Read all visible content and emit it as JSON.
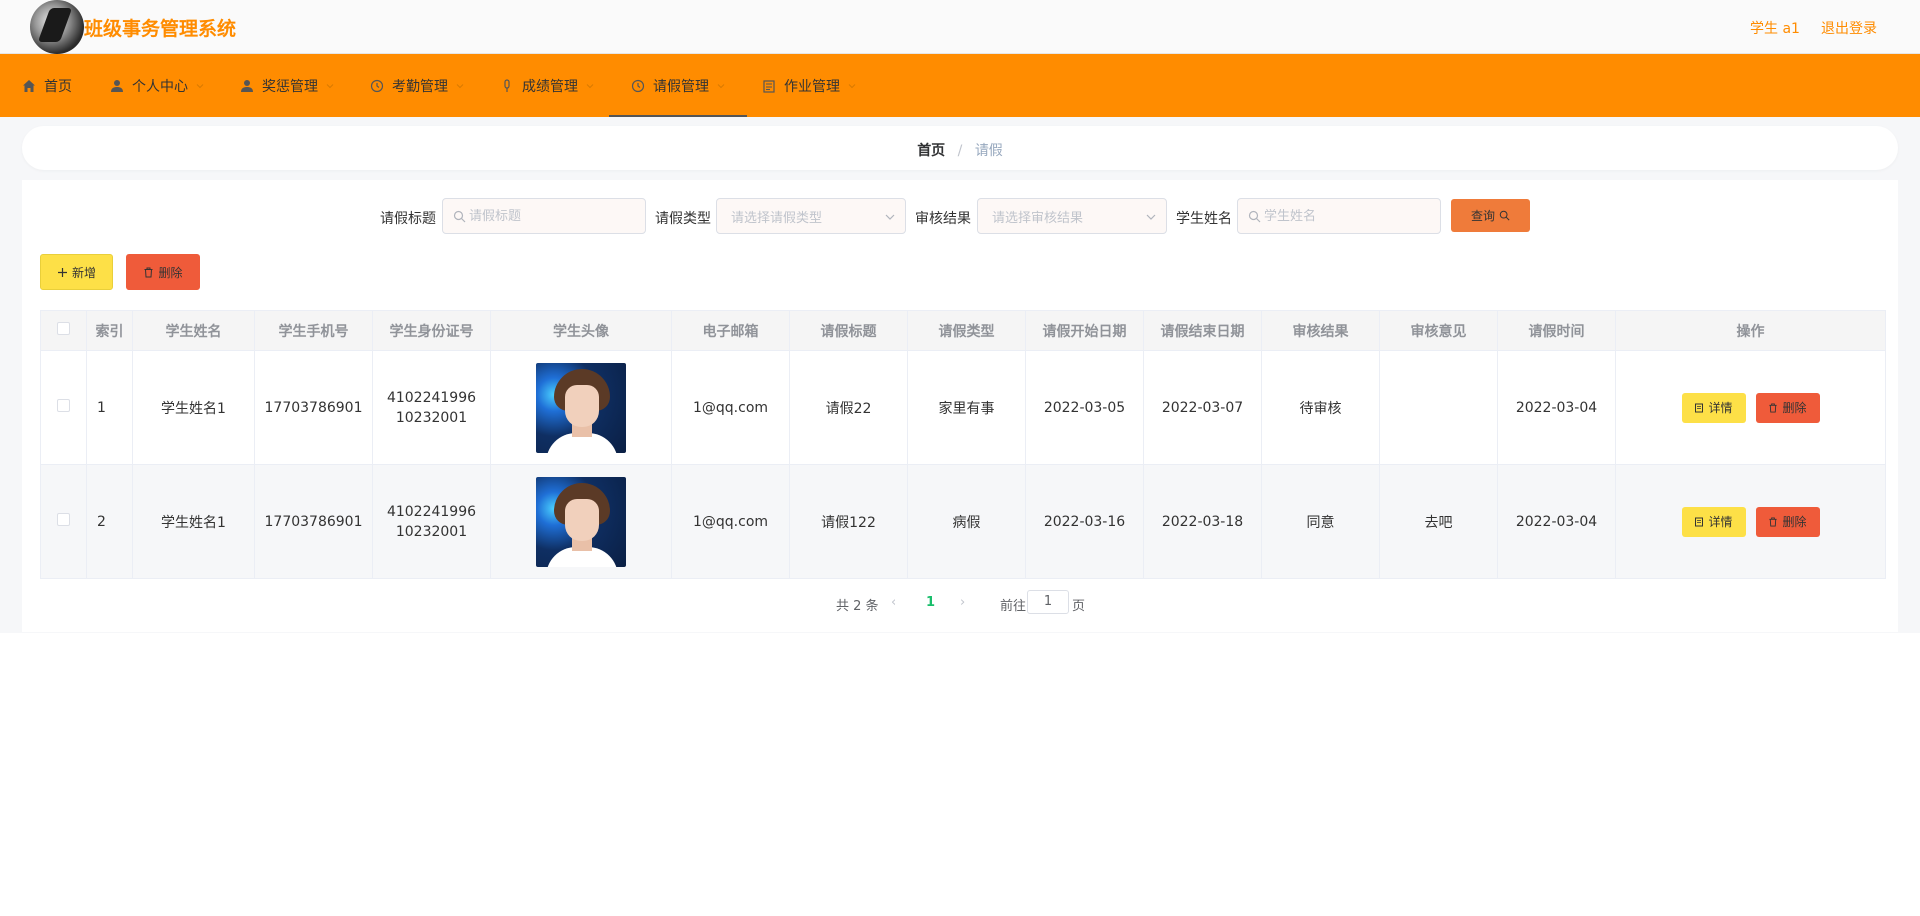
{
  "header": {
    "title": "班级事务管理系统",
    "user": "学生 a1",
    "logout": "退出登录"
  },
  "nav": {
    "items": [
      {
        "label": "首页",
        "icon": "home-icon"
      },
      {
        "label": "个人中心",
        "icon": "user-icon"
      },
      {
        "label": "奖惩管理",
        "icon": "user-icon"
      },
      {
        "label": "考勤管理",
        "icon": "clock-icon"
      },
      {
        "label": "成绩管理",
        "icon": "mic-icon"
      },
      {
        "label": "请假管理",
        "icon": "clock-icon"
      },
      {
        "label": "作业管理",
        "icon": "document-icon"
      }
    ],
    "active": "请假管理"
  },
  "breadcrumb": {
    "home": "首页",
    "separator": "/",
    "current": "请假"
  },
  "filters": {
    "title_label": "请假标题",
    "title_placeholder": "请假标题",
    "type_label": "请假类型",
    "type_placeholder": "请选择请假类型",
    "result_label": "审核结果",
    "result_placeholder": "请选择审核结果",
    "name_label": "学生姓名",
    "name_placeholder": "学生姓名",
    "query_label": "查询"
  },
  "actions": {
    "add_label": "新增",
    "delete_label": "删除"
  },
  "table": {
    "headers": [
      "索引",
      "学生姓名",
      "学生手机号",
      "学生身份证号",
      "学生头像",
      "电子邮箱",
      "请假标题",
      "请假类型",
      "请假开始日期",
      "请假结束日期",
      "审核结果",
      "审核意见",
      "请假时间",
      "操作"
    ],
    "rows": [
      {
        "index": "1",
        "name": "学生姓名1",
        "phone": "17703786901",
        "id_card": "410224199610232001",
        "email": "1@qq.com",
        "title": "请假22",
        "type": "家里有事",
        "start": "2022-03-05",
        "end": "2022-03-07",
        "result": "待审核",
        "opinion": "",
        "time": "2022-03-04"
      },
      {
        "index": "2",
        "name": "学生姓名1",
        "phone": "17703786901",
        "id_card": "410224199610232001",
        "email": "1@qq.com",
        "title": "请假122",
        "type": "病假",
        "start": "2022-03-16",
        "end": "2022-03-18",
        "result": "同意",
        "opinion": "去吧",
        "time": "2022-03-04"
      }
    ],
    "detail_label": "详情",
    "delete_label": "删除"
  },
  "pagination": {
    "total": "共 2 条",
    "current": "1",
    "goto": "前往",
    "page_input": "1",
    "page_suffix": "页"
  },
  "colors": {
    "brand": "#ff8c00",
    "query": "#ef7b3a",
    "add": "#fde047",
    "delete": "#ef5b3a"
  }
}
